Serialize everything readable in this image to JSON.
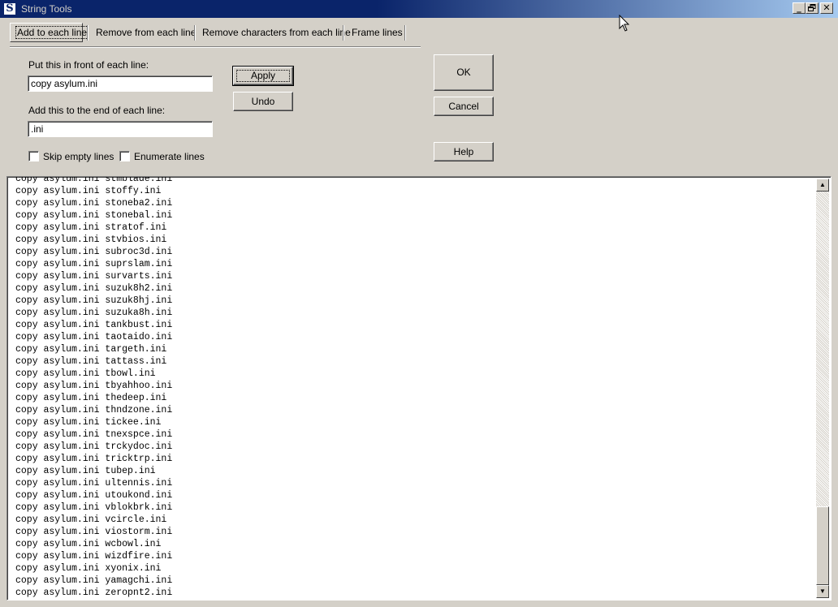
{
  "window": {
    "title": "String Tools",
    "app_icon_letter": "S",
    "minimize_label": "_",
    "restore_label": "§",
    "close_label": "✕"
  },
  "tabs": [
    {
      "label": "Add to each line",
      "active": true
    },
    {
      "label": "Remove from each line",
      "active": false
    },
    {
      "label": "Remove characters from each line",
      "active": false
    },
    {
      "label": "Frame lines",
      "active": false
    }
  ],
  "form": {
    "prefix_label": "Put this in front of each line:",
    "prefix_value": "copy asylum.ini",
    "suffix_label": "Add this to the end of each line:",
    "suffix_value": ".ini",
    "skip_empty_label": "Skip empty lines",
    "skip_empty_checked": false,
    "enumerate_label": "Enumerate lines",
    "enumerate_checked": false
  },
  "buttons": {
    "apply": "Apply",
    "undo": "Undo",
    "ok": "OK",
    "cancel": "Cancel",
    "help": "Help"
  },
  "output_lines": [
    "copy asylum.ini stmblade.ini",
    "copy asylum.ini stoffy.ini",
    "copy asylum.ini stoneba2.ini",
    "copy asylum.ini stonebal.ini",
    "copy asylum.ini stratof.ini",
    "copy asylum.ini stvbios.ini",
    "copy asylum.ini subroc3d.ini",
    "copy asylum.ini suprslam.ini",
    "copy asylum.ini survarts.ini",
    "copy asylum.ini suzuk8h2.ini",
    "copy asylum.ini suzuk8hj.ini",
    "copy asylum.ini suzuka8h.ini",
    "copy asylum.ini tankbust.ini",
    "copy asylum.ini taotaido.ini",
    "copy asylum.ini targeth.ini",
    "copy asylum.ini tattass.ini",
    "copy asylum.ini tbowl.ini",
    "copy asylum.ini tbyahhoo.ini",
    "copy asylum.ini thedeep.ini",
    "copy asylum.ini thndzone.ini",
    "copy asylum.ini tickee.ini",
    "copy asylum.ini tnexspce.ini",
    "copy asylum.ini trckydoc.ini",
    "copy asylum.ini tricktrp.ini",
    "copy asylum.ini tubep.ini",
    "copy asylum.ini ultennis.ini",
    "copy asylum.ini utoukond.ini",
    "copy asylum.ini vblokbrk.ini",
    "copy asylum.ini vcircle.ini",
    "copy asylum.ini viostorm.ini",
    "copy asylum.ini wcbowl.ini",
    "copy asylum.ini wizdfire.ini",
    "copy asylum.ini xyonix.ini",
    "copy asylum.ini yamagchi.ini",
    "copy asylum.ini zeropnt2.ini"
  ],
  "colors": {
    "titlebar_start": "#0a246a",
    "titlebar_end": "#a6caf0",
    "face": "#d4d0c8"
  }
}
